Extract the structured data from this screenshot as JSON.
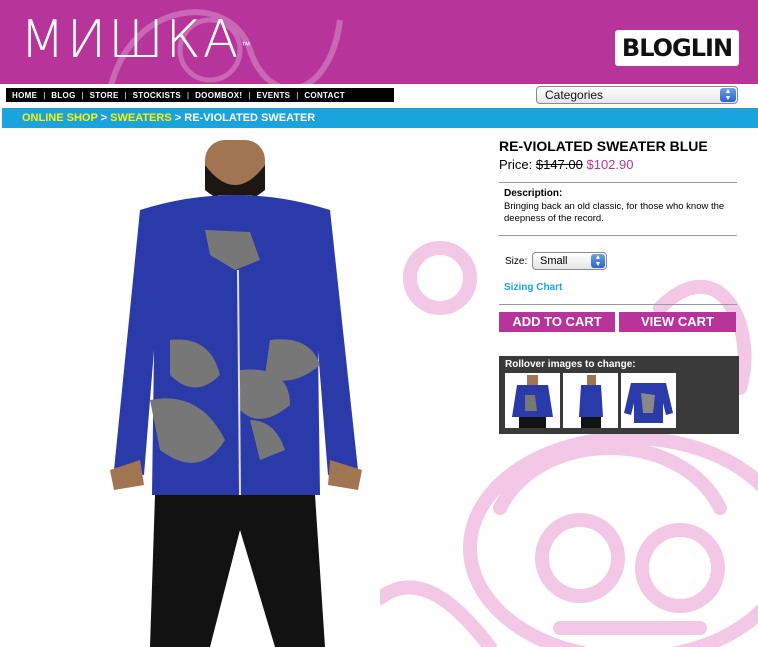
{
  "header": {
    "logo_text": "МИШКА",
    "logo_mark": "™",
    "bloglin_text": "BLOGLIN"
  },
  "nav": {
    "items": [
      "HOME",
      "BLOG",
      "STORE",
      "STOCKISTS",
      "DOOMBOX!",
      "EVENTS",
      "CONTACT"
    ]
  },
  "categories": {
    "selected": "Categories"
  },
  "breadcrumb": {
    "items": [
      "ONLINE SHOP",
      "SWEATERS",
      "RE-VIOLATED SWEATER"
    ],
    "separator": ">"
  },
  "product": {
    "title": "RE-VIOLATED SWEATER BLUE",
    "price_label": "Price:",
    "old_price": "$147.00",
    "new_price": "$102.90",
    "description_label": "Description:",
    "description": "Bringing back an old classic, for those who know the deepness of the record.",
    "size_label": "Size:",
    "size_selected": "Small",
    "sizing_chart": "Sizing Chart",
    "add_to_cart": "ADD TO CART",
    "view_cart": "VIEW CART",
    "rollover_label": "Rollover images to change:"
  },
  "colors": {
    "brand_magenta": "#b7359b",
    "nav_blue": "#1ba3dd",
    "crumb_yellow": "#fff200",
    "sweater_blue": "#2a3aa8"
  }
}
